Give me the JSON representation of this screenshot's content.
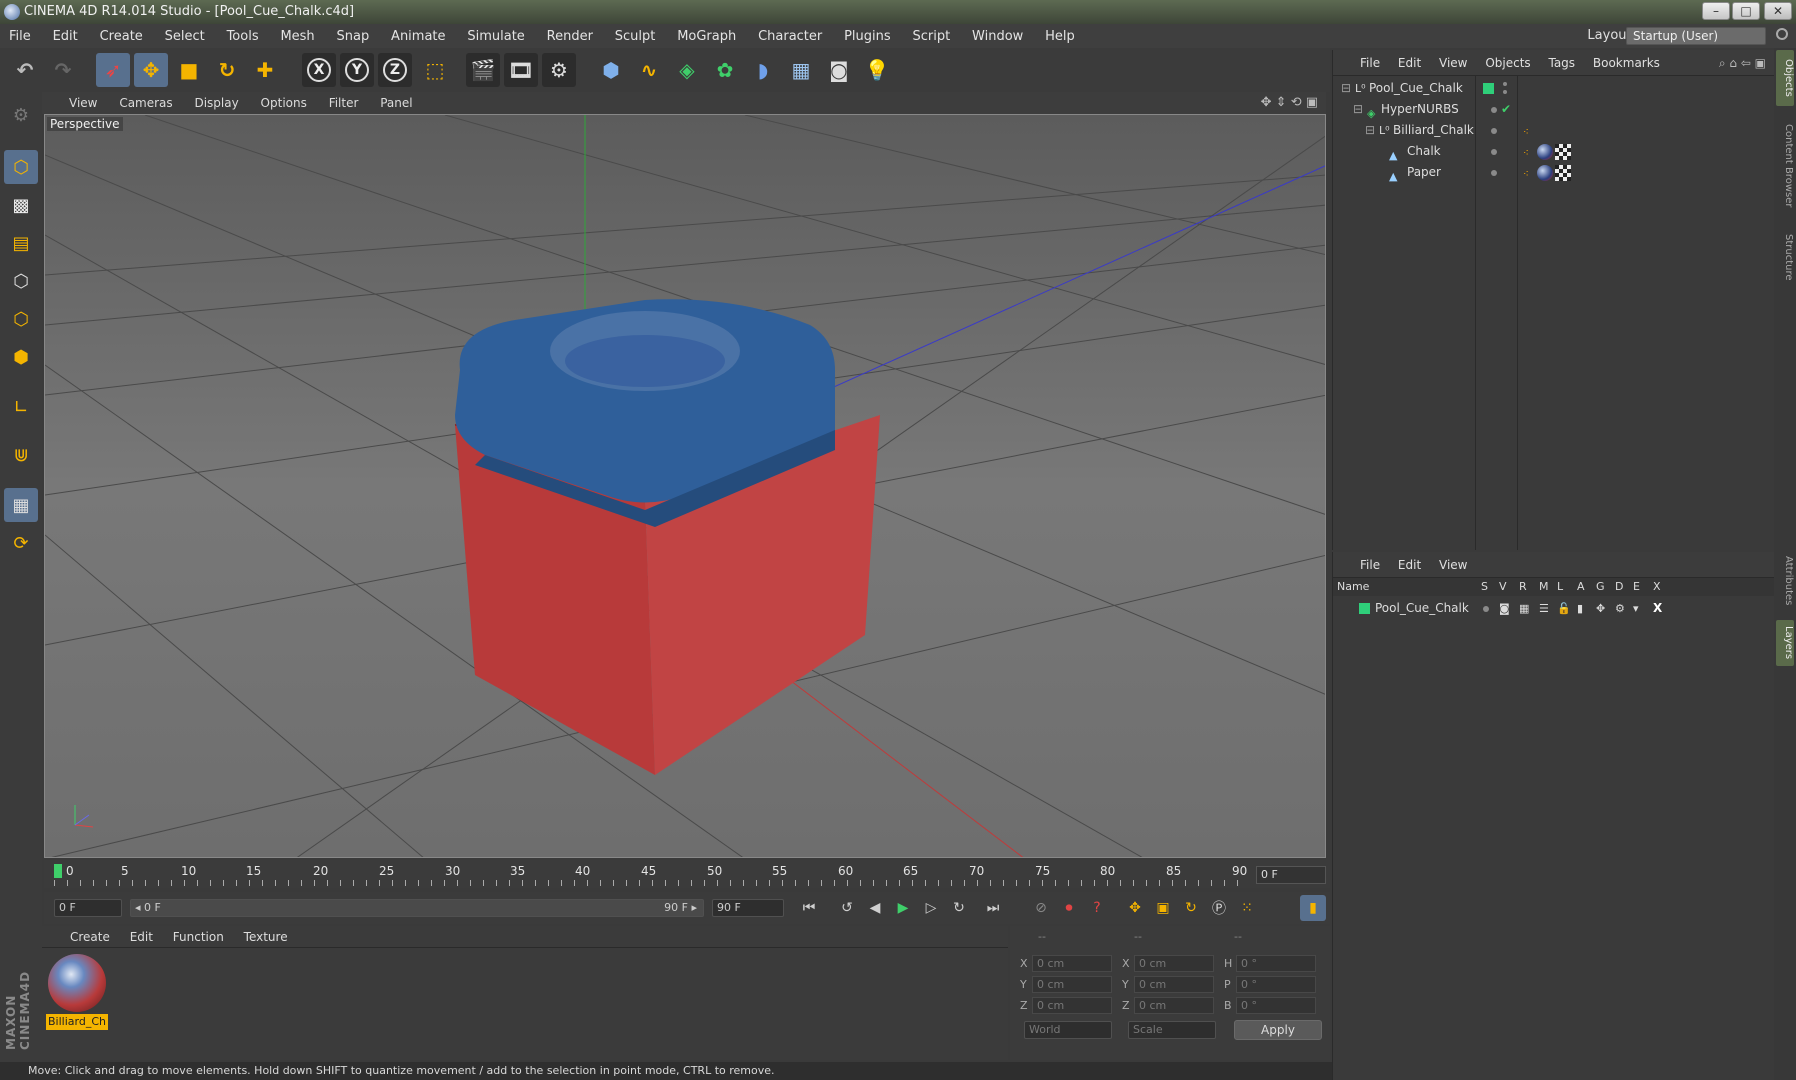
{
  "window": {
    "title": "CINEMA 4D R14.014 Studio - [Pool_Cue_Chalk.c4d]",
    "controls": [
      "–",
      "□",
      "✕"
    ]
  },
  "menubar": {
    "items": [
      "File",
      "Edit",
      "Create",
      "Select",
      "Tools",
      "Mesh",
      "Snap",
      "Animate",
      "Simulate",
      "Render",
      "Sculpt",
      "MoGraph",
      "Character",
      "Plugins",
      "Script",
      "Window",
      "Help"
    ],
    "layout_label": "Layout:",
    "layout_value": "Startup (User)"
  },
  "toolbar": {
    "axis_x": "X",
    "axis_y": "Y",
    "axis_z": "Z"
  },
  "viewport": {
    "menu": [
      "View",
      "Cameras",
      "Display",
      "Options",
      "Filter",
      "Panel"
    ],
    "label": "Perspective",
    "colors": {
      "grid_axis_x": "#c03a3a",
      "grid_axis_y": "#2fa63a",
      "grid_axis_z": "#3a3ac8",
      "chalk_blue": "#2f5f9a",
      "paper_red": "#b83a3a"
    }
  },
  "timeline": {
    "ticks": [
      "0",
      "5",
      "10",
      "15",
      "20",
      "25",
      "30",
      "35",
      "40",
      "45",
      "50",
      "55",
      "60",
      "65",
      "70",
      "75",
      "80",
      "85",
      "90"
    ],
    "current_frame_box": "0 F"
  },
  "transport": {
    "start_field": "0 F",
    "range_start": "◂ 0 F",
    "range_end": "90 F ▸",
    "end_field": "90 F"
  },
  "material_panel": {
    "menu": [
      "Create",
      "Edit",
      "Function",
      "Texture"
    ],
    "material_name": "Billiard_Ch"
  },
  "coordinates": {
    "header": [
      "--",
      "--",
      "--"
    ],
    "rows": [
      {
        "a_label": "X",
        "a_value": "0 cm",
        "b_label": "X",
        "b_value": "0 cm",
        "c_label": "H",
        "c_value": "0 °"
      },
      {
        "a_label": "Y",
        "a_value": "0 cm",
        "b_label": "Y",
        "b_value": "0 cm",
        "c_label": "P",
        "c_value": "0 °"
      },
      {
        "a_label": "Z",
        "a_value": "0 cm",
        "b_label": "Z",
        "b_value": "0 cm",
        "c_label": "B",
        "c_value": "0 °"
      }
    ],
    "space_select": "World",
    "mode_select": "Scale",
    "apply_label": "Apply"
  },
  "status": {
    "text": "Move: Click and drag to move elements. Hold down SHIFT to quantize movement / add to the selection in point mode, CTRL to remove."
  },
  "object_manager": {
    "menu": [
      "File",
      "Edit",
      "View",
      "Objects",
      "Tags",
      "Bookmarks"
    ],
    "objects": [
      {
        "name": "Pool_Cue_Chalk",
        "icon": "null-icon"
      },
      {
        "name": "HyperNURBS",
        "icon": "hypernurbs-icon"
      },
      {
        "name": "Billiard_Chalk",
        "icon": "null-icon"
      },
      {
        "name": "Chalk",
        "icon": "polygon-icon"
      },
      {
        "name": "Paper",
        "icon": "polygon-icon"
      }
    ]
  },
  "layer_manager": {
    "menu": [
      "File",
      "Edit",
      "View"
    ],
    "columns": [
      "Name",
      "S",
      "V",
      "R",
      "M",
      "L",
      "A",
      "G",
      "D",
      "E",
      "X"
    ],
    "layers": [
      {
        "name": "Pool_Cue_Chalk",
        "color": "#2fcf7a"
      }
    ]
  },
  "side_tabs": [
    "Objects",
    "Content Browser",
    "Structure",
    "Attributes",
    "Layers"
  ]
}
